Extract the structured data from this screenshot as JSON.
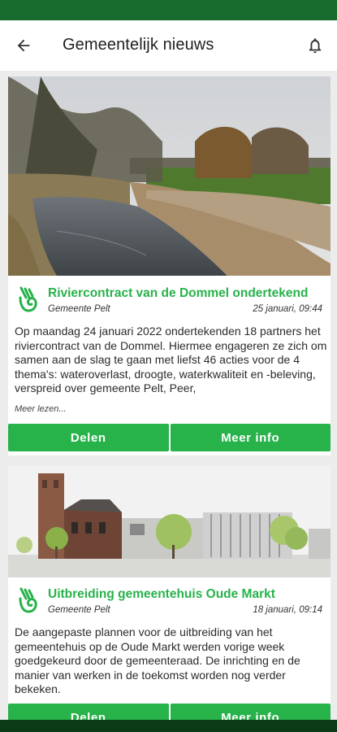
{
  "header": {
    "title": "Gemeentelijk nieuws",
    "back_icon": "arrow-left-icon",
    "bell_icon": "bell-icon"
  },
  "colors": {
    "status_bar": "#176b2c",
    "accent": "#27b24a"
  },
  "articles": [
    {
      "title": "Riviercontract van de Dommel ondertekend",
      "source": "Gemeente Pelt",
      "date": "25 januari, 09:44",
      "body": "Op maandag 24 januari 2022 ondertekenden 18 partners het riviercontract van de Dommel. Hiermee engageren ze zich om samen aan de slag te gaan met liefst 46 acties voor de 4 thema's: wateroverlast, droogte, waterkwaliteit en -beleving, verspreid over gemeente Pelt, Peer,",
      "read_more": "Meer lezen...",
      "share_label": "Delen",
      "info_label": "Meer info",
      "image": "river-landscape-photo"
    },
    {
      "title": "Uitbreiding gemeentehuis Oude Markt",
      "source": "Gemeente Pelt",
      "date": "18 januari, 09:14",
      "body": "De aangepaste plannen voor de uitbreiding van het gemeentehuis op de Oude Markt werden vorige week goedgekeurd door de gemeenteraad. De inrichting en de manier van werken in de toekomst worden nog verder bekeken.",
      "share_label": "Delen",
      "info_label": "Meer info",
      "image": "town-hall-rendering"
    }
  ]
}
